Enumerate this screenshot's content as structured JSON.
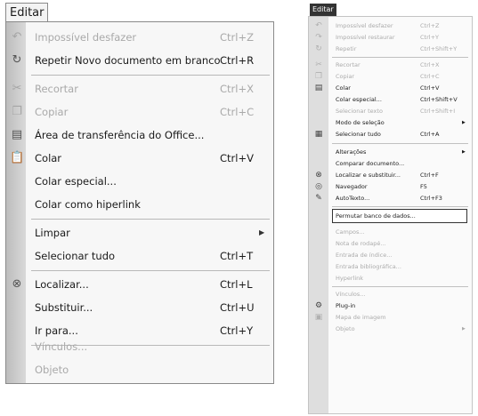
{
  "left_menu": {
    "title": "Editar",
    "items": [
      {
        "label": "Impossível desfazer",
        "shortcut": "Ctrl+Z",
        "icon": "undo-icon"
      },
      {
        "label": "Repetir Novo documento em branco",
        "shortcut": "Ctrl+R",
        "icon": "redo-icon"
      },
      {
        "label": "Recortar",
        "shortcut": "Ctrl+X",
        "icon": "cut-icon"
      },
      {
        "label": "Copiar",
        "shortcut": "Ctrl+C",
        "icon": "copy-icon"
      },
      {
        "label": "Área de transferência do Office...",
        "shortcut": "",
        "icon": "clipboard-icon"
      },
      {
        "label": "Colar",
        "shortcut": "Ctrl+V",
        "icon": "paste-icon"
      },
      {
        "label": "Colar especial...",
        "shortcut": ""
      },
      {
        "label": "Colar como hiperlink",
        "shortcut": ""
      },
      {
        "label": "Limpar",
        "shortcut": ""
      },
      {
        "label": "Selecionar tudo",
        "shortcut": "Ctrl+T"
      },
      {
        "label": "Localizar...",
        "shortcut": "Ctrl+L",
        "icon": "binoculars-icon"
      },
      {
        "label": "Substituir...",
        "shortcut": "Ctrl+U"
      },
      {
        "label": "Ir para...",
        "shortcut": "Ctrl+Y"
      },
      {
        "label": "Vínculos...",
        "shortcut": ""
      },
      {
        "label": "Objeto",
        "shortcut": ""
      }
    ]
  },
  "right_menu": {
    "title": "Editar",
    "items": [
      {
        "label": "Impossível desfazer",
        "shortcut": "Ctrl+Z",
        "icon": "undo-icon"
      },
      {
        "label": "Impossível restaurar",
        "shortcut": "Ctrl+Y",
        "icon": "redo-icon"
      },
      {
        "label": "Repetir",
        "shortcut": "Ctrl+Shift+Y",
        "icon": "repeat-icon"
      },
      {
        "label": "Recortar",
        "shortcut": "Ctrl+X",
        "icon": "cut-icon"
      },
      {
        "label": "Copiar",
        "shortcut": "Ctrl+C",
        "icon": "copy-icon"
      },
      {
        "label": "Colar",
        "shortcut": "Ctrl+V",
        "icon": "paste-icon"
      },
      {
        "label": "Colar especial...",
        "shortcut": "Ctrl+Shift+V"
      },
      {
        "label": "Selecionar texto",
        "shortcut": "Ctrl+Shift+I"
      },
      {
        "label": "Modo de seleção",
        "shortcut": ""
      },
      {
        "label": "Selecionar tudo",
        "shortcut": "Ctrl+A",
        "icon": "select-all-icon"
      },
      {
        "label": "Alterações",
        "shortcut": ""
      },
      {
        "label": "Comparar documento...",
        "shortcut": ""
      },
      {
        "label": "Localizar e substituir...",
        "shortcut": "Ctrl+F",
        "icon": "binoculars-icon"
      },
      {
        "label": "Navegador",
        "shortcut": "F5",
        "icon": "navigator-icon"
      },
      {
        "label": "AutoTexto...",
        "shortcut": "Ctrl+F3",
        "icon": "autotext-icon"
      },
      {
        "label": "Permutar banco de dados...",
        "shortcut": ""
      },
      {
        "label": "Campos...",
        "shortcut": ""
      },
      {
        "label": "Nota de rodapé...",
        "shortcut": ""
      },
      {
        "label": "Entrada de índice...",
        "shortcut": ""
      },
      {
        "label": "Entrada bibliográfica...",
        "shortcut": ""
      },
      {
        "label": "Hyperlink",
        "shortcut": ""
      },
      {
        "label": "Vínculos...",
        "shortcut": ""
      },
      {
        "label": "Plug-in",
        "shortcut": "",
        "icon": "plugin-icon"
      },
      {
        "label": "Mapa de imagem",
        "shortcut": "",
        "icon": "image-map-icon"
      },
      {
        "label": "Objeto",
        "shortcut": ""
      }
    ]
  }
}
